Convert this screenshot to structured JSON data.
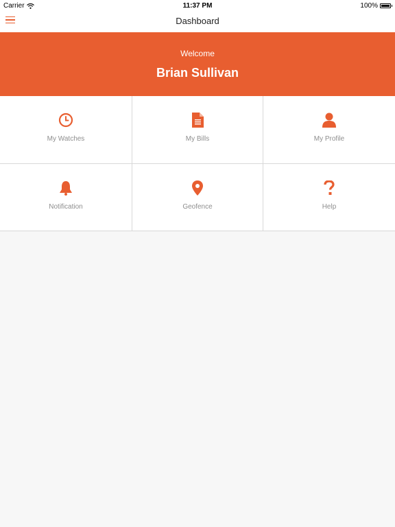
{
  "status_bar": {
    "carrier": "Carrier",
    "time": "11:37 PM",
    "battery": "100%"
  },
  "nav": {
    "title": "Dashboard",
    "menu_icon": "hamburger-menu-icon"
  },
  "welcome": {
    "label": "Welcome",
    "name": "Brian Sullivan"
  },
  "accent_color": "#e85e30",
  "tiles": [
    {
      "label": "My Watches",
      "icon": "clock-icon"
    },
    {
      "label": "My Bills",
      "icon": "document-icon"
    },
    {
      "label": "My Profile",
      "icon": "user-icon"
    },
    {
      "label": "Notification",
      "icon": "bell-icon"
    },
    {
      "label": "Geofence",
      "icon": "map-pin-icon"
    },
    {
      "label": "Help",
      "icon": "question-icon"
    }
  ]
}
